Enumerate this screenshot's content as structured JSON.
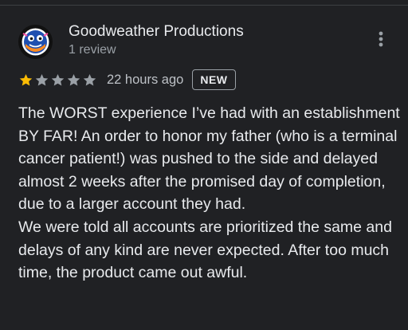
{
  "reviewer": {
    "name": "Goodweather Productions",
    "review_count": "1 review",
    "avatar_icon": "goodweather-logo-icon"
  },
  "menu": {
    "icon": "more-vert-icon"
  },
  "rating": {
    "stars": 1,
    "max_stars": 5,
    "filled_color": "#fbbc04",
    "empty_color": "#9aa0a6",
    "time": "22 hours ago",
    "badge": "NEW"
  },
  "review": {
    "text": "The WORST experience I’ve had with an establishment BY FAR! An order to honor my father  (who is a terminal cancer patient!) was pushed to the side and delayed almost 2 weeks after the promised day of completion, due to a larger account they had.\nWe were told all accounts are prioritized the same and delays of any kind are never expected. After too much time, the product came out awful."
  },
  "colors": {
    "background": "#202124",
    "text_primary": "#e8eaed",
    "text_secondary": "#9aa0a6"
  }
}
